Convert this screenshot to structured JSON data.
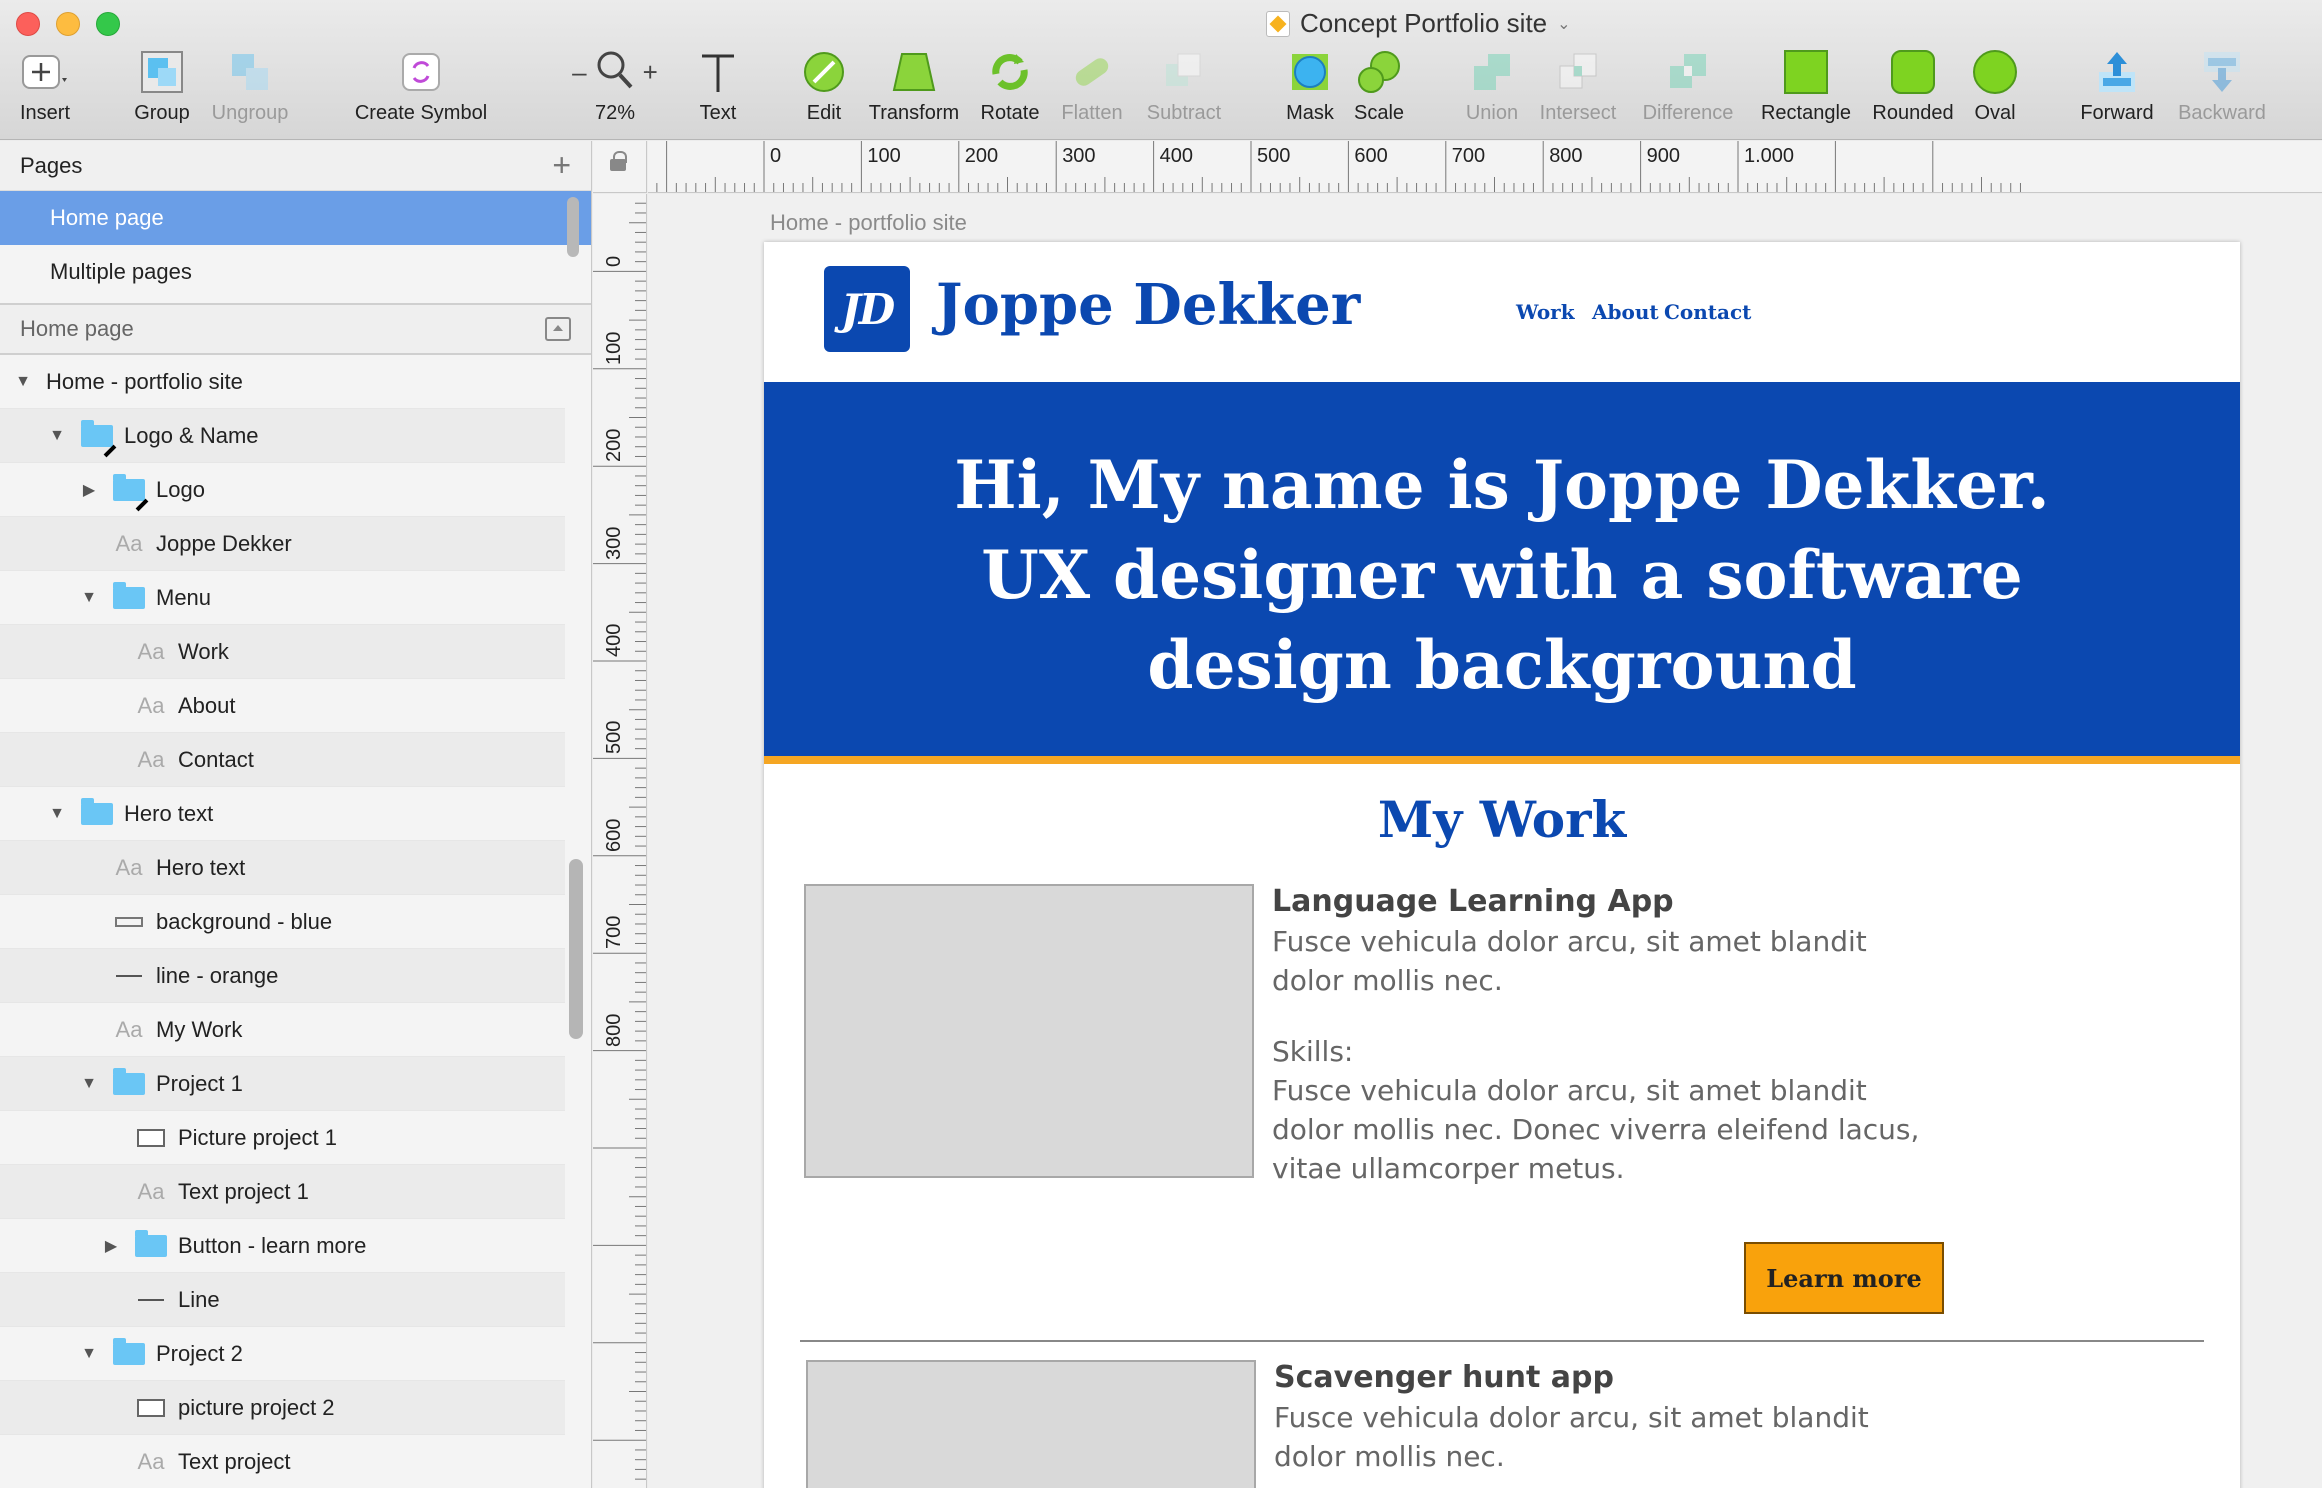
{
  "window": {
    "title": "Concept Portfolio site"
  },
  "toolbar": {
    "insert": "Insert",
    "group": "Group",
    "ungroup": "Ungroup",
    "create_symbol": "Create Symbol",
    "zoom_minus": "–",
    "zoom": "72%",
    "zoom_plus": "+",
    "text": "Text",
    "edit": "Edit",
    "transform": "Transform",
    "rotate": "Rotate",
    "flatten": "Flatten",
    "subtract": "Subtract",
    "mask": "Mask",
    "scale": "Scale",
    "union": "Union",
    "intersect": "Intersect",
    "difference": "Difference",
    "rectangle": "Rectangle",
    "rounded": "Rounded",
    "oval": "Oval",
    "forward": "Forward",
    "backward": "Backward"
  },
  "pages": {
    "header": "Pages",
    "items": [
      {
        "label": "Home page",
        "selected": true
      },
      {
        "label": "Multiple pages",
        "selected": false
      }
    ]
  },
  "layers": {
    "header": "Home page",
    "items": [
      {
        "label": "Home - portfolio site",
        "depth": 0,
        "disclosure": "open",
        "icon": "none"
      },
      {
        "label": "Logo & Name",
        "depth": 1,
        "disclosure": "open",
        "icon": "folder-masked"
      },
      {
        "label": "Logo",
        "depth": 2,
        "disclosure": "closed",
        "icon": "folder-masked"
      },
      {
        "label": "Joppe Dekker",
        "depth": 2,
        "disclosure": "none",
        "icon": "text",
        "icon_glyph": "Aa",
        "depth_adj": -1
      },
      {
        "label": "Menu",
        "depth": 2,
        "disclosure": "open",
        "icon": "folder"
      },
      {
        "label": "Work",
        "depth": 3,
        "disclosure": "none",
        "icon": "text",
        "icon_glyph": "Aa"
      },
      {
        "label": "About",
        "depth": 3,
        "disclosure": "none",
        "icon": "text",
        "icon_glyph": "Aa"
      },
      {
        "label": "Contact",
        "depth": 3,
        "disclosure": "none",
        "icon": "text",
        "icon_glyph": "Aa"
      },
      {
        "label": "Hero text",
        "depth": 1,
        "disclosure": "open",
        "icon": "folder"
      },
      {
        "label": "Hero text",
        "depth": 2,
        "disclosure": "none",
        "icon": "text",
        "icon_glyph": "Aa"
      },
      {
        "label": "background - blue",
        "depth": 2,
        "disclosure": "none",
        "icon": "shape"
      },
      {
        "label": "line - orange",
        "depth": 2,
        "disclosure": "none",
        "icon": "line"
      },
      {
        "label": "My Work",
        "depth": 2,
        "disclosure": "none",
        "icon": "text",
        "icon_glyph": "Aa"
      },
      {
        "label": "Project 1",
        "depth": 2,
        "disclosure": "open",
        "icon": "folder"
      },
      {
        "label": "Picture project 1",
        "depth": 3,
        "disclosure": "none",
        "icon": "rect"
      },
      {
        "label": "Text project 1",
        "depth": 3,
        "disclosure": "none",
        "icon": "text",
        "icon_glyph": "Aa"
      },
      {
        "label": "Button - learn more",
        "depth": 3,
        "disclosure": "closed",
        "icon": "folder"
      },
      {
        "label": "Line",
        "depth": 3,
        "disclosure": "none",
        "icon": "line"
      },
      {
        "label": "Project 2",
        "depth": 2,
        "disclosure": "open",
        "icon": "folder"
      },
      {
        "label": "picture project 2",
        "depth": 3,
        "disclosure": "none",
        "icon": "rect"
      },
      {
        "label": "Text project",
        "depth": 3,
        "disclosure": "none",
        "icon": "text",
        "icon_glyph": "Aa"
      }
    ]
  },
  "rulers": {
    "horizontal": [
      "0",
      "100",
      "200",
      "300",
      "400",
      "500",
      "600",
      "700",
      "800",
      "900",
      "1.000"
    ],
    "vertical": [
      "0",
      "100",
      "200",
      "300",
      "400",
      "500",
      "600",
      "700",
      "800"
    ]
  },
  "canvas": {
    "artboard_label": "Home - portfolio site",
    "site": {
      "logo_text": "JD",
      "name": "Joppe Dekker",
      "nav": [
        "Work",
        "About",
        "Contact"
      ],
      "hero": [
        "Hi, My name is Joppe Dekker.",
        "UX designer with a software",
        "design background"
      ],
      "section_title": "My Work",
      "project1": {
        "title": "Language Learning App",
        "description": "Fusce vehicula dolor arcu, sit amet blandit dolor mollis nec.",
        "skills_label": "Skills:",
        "skills": "Fusce vehicula dolor arcu, sit amet blandit dolor mollis nec. Donec viverra eleifend lacus, vitae ullamcorper metus.",
        "button": "Learn more"
      },
      "project2": {
        "title": "Scavenger hunt app",
        "description": "Fusce vehicula dolor arcu, sit amet blandit dolor mollis nec."
      }
    }
  },
  "colors": {
    "brand_blue": "#0b48b0",
    "accent_orange": "#f5a623",
    "button_orange": "#f9a20c",
    "selection_blue": "#6a9ee7",
    "shape_green": "#7ed321"
  }
}
